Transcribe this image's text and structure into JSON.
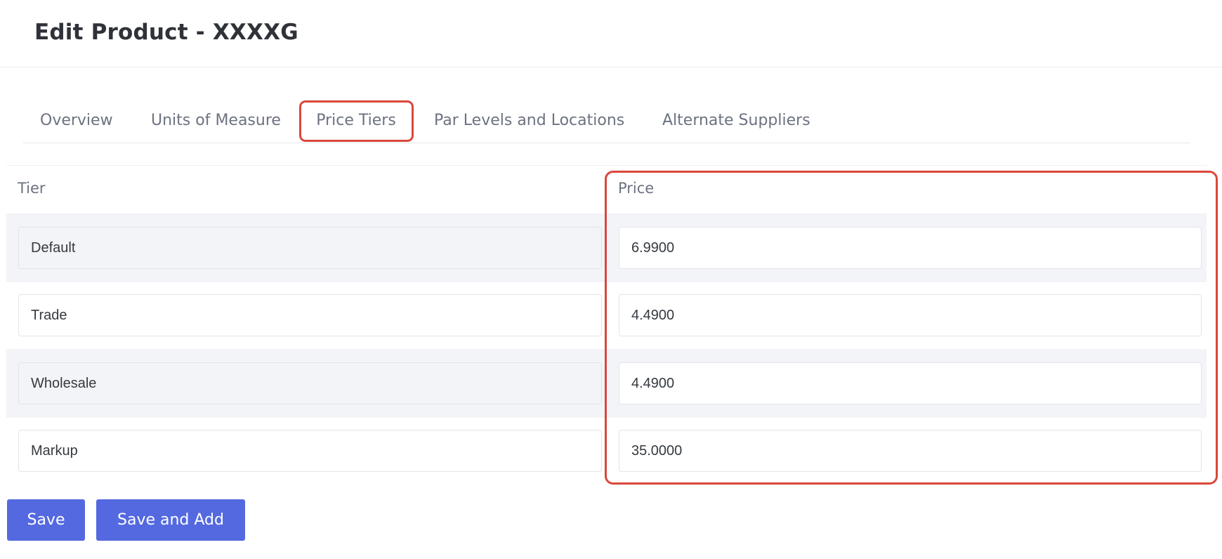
{
  "header": {
    "title": "Edit Product - XXXXG"
  },
  "tabs": [
    {
      "label": "Overview"
    },
    {
      "label": "Units of Measure"
    },
    {
      "label": "Price Tiers",
      "active": true
    },
    {
      "label": "Par Levels and Locations"
    },
    {
      "label": "Alternate Suppliers"
    }
  ],
  "table": {
    "headers": {
      "tier": "Tier",
      "price": "Price"
    },
    "rows": [
      {
        "tier": "Default",
        "price": "6.9900"
      },
      {
        "tier": "Trade",
        "price": "4.4900"
      },
      {
        "tier": "Wholesale",
        "price": "4.4900"
      },
      {
        "tier": "Markup",
        "price": "35.0000"
      }
    ]
  },
  "buttons": {
    "save": "Save",
    "save_and_add": "Save and Add"
  },
  "colors": {
    "primary": "#5469e0",
    "highlight": "#d9483b",
    "stripe": "#f3f4f7"
  }
}
